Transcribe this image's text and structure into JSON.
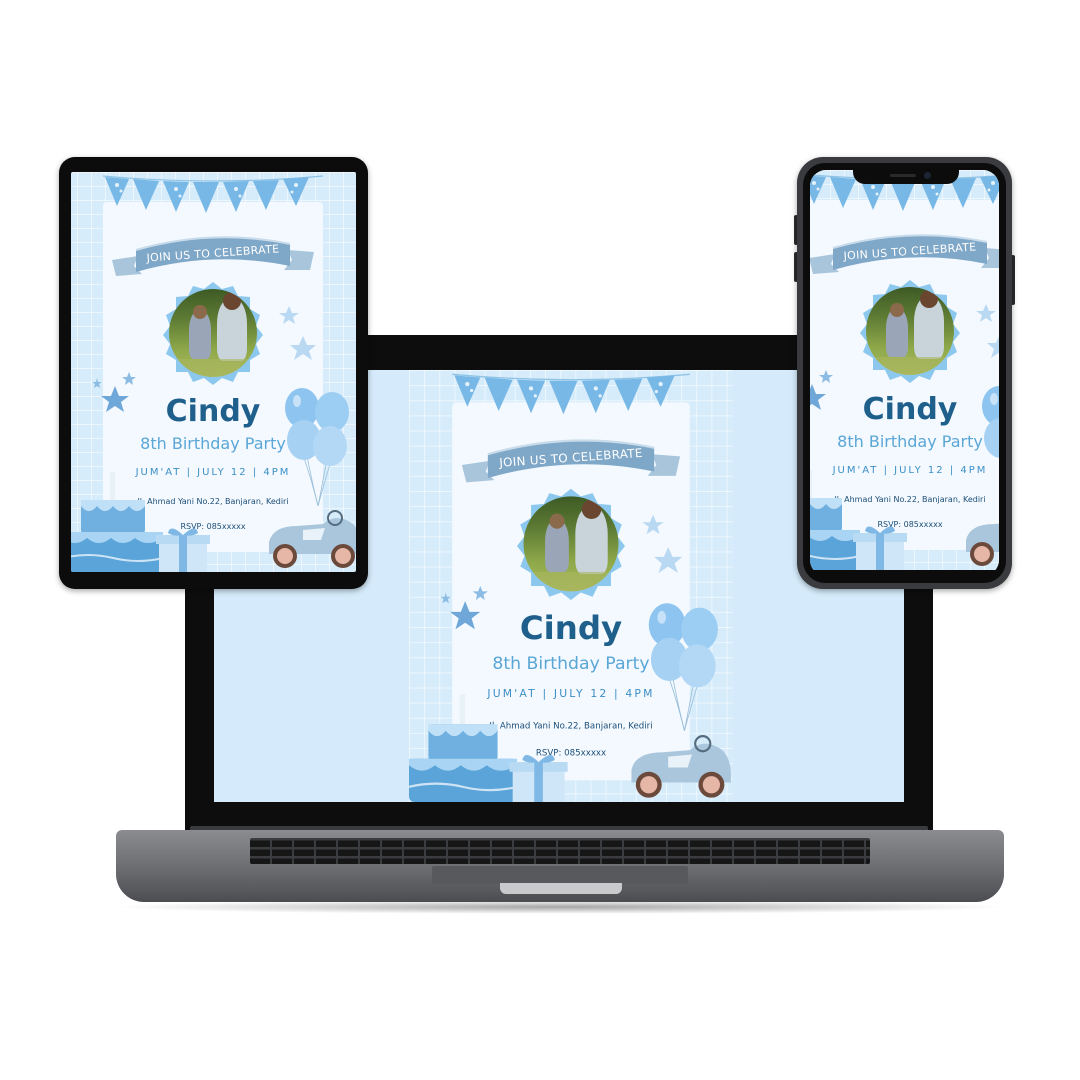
{
  "invitation": {
    "header_banner": "JOIN US TO CELEBRATE",
    "name": "Cindy",
    "subtitle": "8th Birthday Party",
    "when": "JUM'AT | JULY 12 | 4PM",
    "address": "Jl. Ahmad Yani No.22, Banjaran, Kediri",
    "rsvp": "RSVP: 085xxxxx"
  },
  "colors": {
    "background_blue": "#d6ecfb",
    "panel": "#f3f9ff",
    "name_text": "#1f5f8b",
    "subtitle_text": "#5aa6d6",
    "accent_blue": "#6fb7e8"
  },
  "devices": [
    "laptop",
    "tablet",
    "phone"
  ],
  "icons": [
    "bunting-icon",
    "ribbon-banner-icon",
    "star-icon",
    "balloon-icon",
    "cake-icon",
    "gift-icon",
    "toy-car-icon"
  ]
}
